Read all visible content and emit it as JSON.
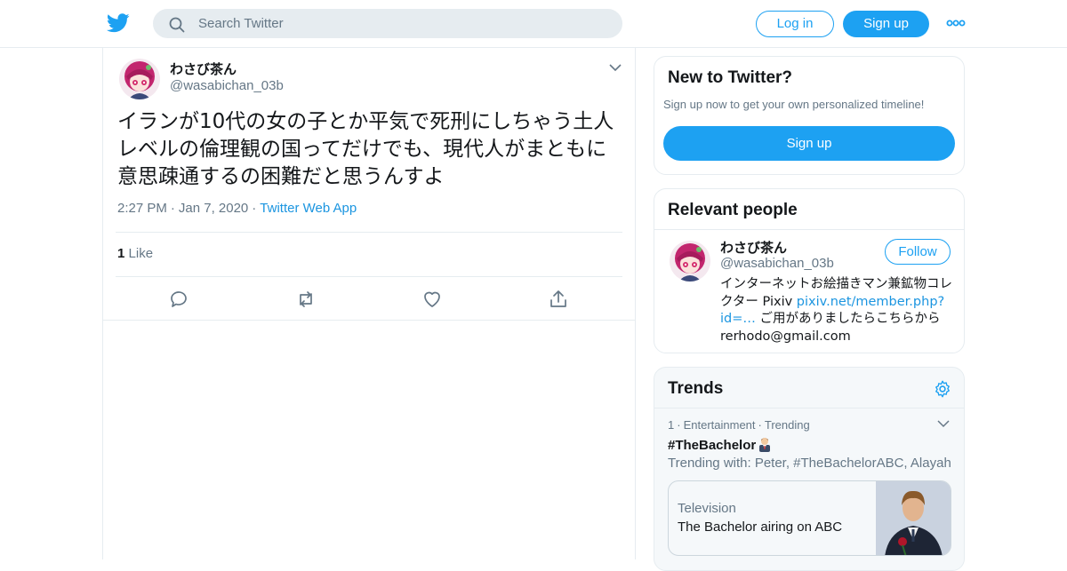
{
  "header": {
    "search_placeholder": "Search Twitter",
    "login_label": "Log in",
    "signup_label": "Sign up",
    "logo_icon": "twitter-bird-icon",
    "more_icon": "more-dots-icon",
    "accent_color": "#1da1f2"
  },
  "tweet": {
    "name": "わさび茶ん",
    "handle": "@wasabichan_03b",
    "text": "イランが10代の女の子とか平気で死刑にしちゃう土人レベルの倫理観の国ってだけでも、現代人がまともに意思疎通するの困難だと思うんすよ",
    "time": "2:27 PM",
    "date": "Jan 7, 2020",
    "source": "Twitter Web App",
    "meta_separator": "·",
    "like_count": "1",
    "like_label": "Like",
    "actions": [
      "reply-icon",
      "retweet-icon",
      "like-heart-icon",
      "share-icon"
    ]
  },
  "sidebar": {
    "new_to_twitter": {
      "title": "New to Twitter?",
      "subtitle": "Sign up now to get your own personalized timeline!",
      "signup_label": "Sign up"
    },
    "relevant_people": {
      "title": "Relevant people",
      "name": "わさび茶ん",
      "handle": "@wasabichan_03b",
      "follow_label": "Follow",
      "bio_prefix": "インターネットお絵描きマン兼鉱物コレクター Pixiv ",
      "bio_link": "pixiv.net/member.php?id=…",
      "bio_suffix": " ご用がありましたらこちらから rerhodo@gmail.com"
    },
    "trends": {
      "title": "Trends",
      "rank": "1",
      "category": "Entertainment",
      "meta_separator": "·",
      "status": "Trending",
      "name": "#TheBachelor",
      "trending_with": "Trending with: Peter, #TheBachelorABC, Alayah",
      "card_category": "Television",
      "card_title": "The Bachelor airing on ABC"
    }
  }
}
